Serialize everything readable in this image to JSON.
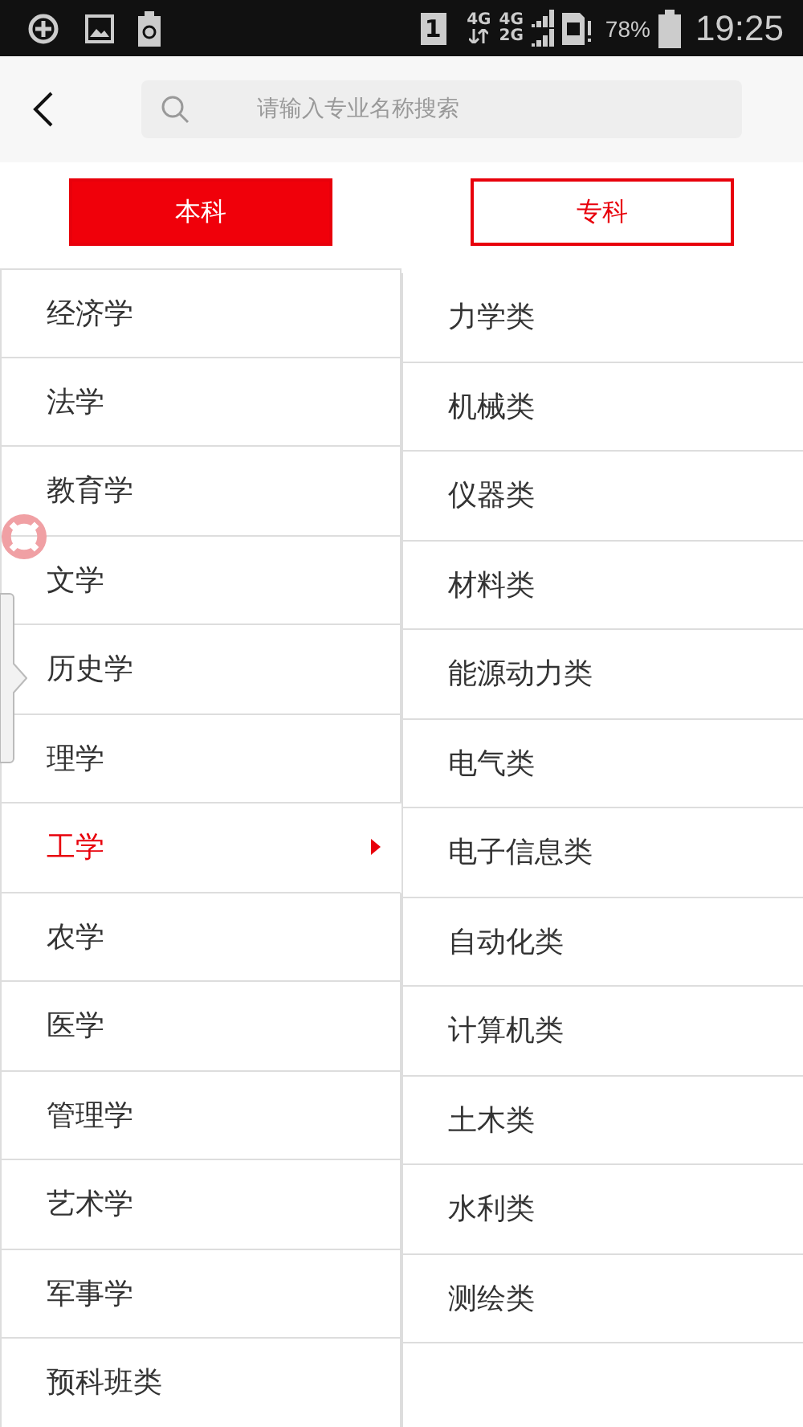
{
  "status_bar": {
    "sim_slot": "1",
    "network_top": "4G",
    "network_a": "4G",
    "network_b": "2G",
    "battery": "78%",
    "time": "19:25"
  },
  "search": {
    "placeholder": "请输入专业名称搜索"
  },
  "tabs": [
    {
      "label": "本科",
      "selected": true
    },
    {
      "label": "专科",
      "selected": false
    }
  ],
  "categories": [
    {
      "label": "经济学",
      "selected": false
    },
    {
      "label": "法学",
      "selected": false
    },
    {
      "label": "教育学",
      "selected": false
    },
    {
      "label": "文学",
      "selected": false
    },
    {
      "label": "历史学",
      "selected": false
    },
    {
      "label": "理学",
      "selected": false
    },
    {
      "label": "工学",
      "selected": true
    },
    {
      "label": "农学",
      "selected": false
    },
    {
      "label": "医学",
      "selected": false
    },
    {
      "label": "管理学",
      "selected": false
    },
    {
      "label": "艺术学",
      "selected": false
    },
    {
      "label": "军事学",
      "selected": false
    },
    {
      "label": "预科班类",
      "selected": false
    }
  ],
  "subcategories": [
    "力学类",
    "机械类",
    "仪器类",
    "材料类",
    "能源动力类",
    "电气类",
    "电子信息类",
    "自动化类",
    "计算机类",
    "土木类",
    "水利类",
    "测绘类"
  ]
}
